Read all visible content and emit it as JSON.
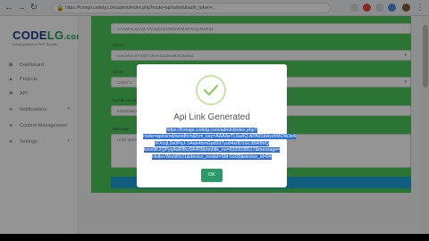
{
  "browser": {
    "url": "https://fcmapi.codelg.com/admin/index.php?route=api/admin&auth_token=...",
    "nav_back": "←",
    "nav_forward": "→",
    "nav_reload": "↻",
    "lock": "🔒"
  },
  "sidebar": {
    "logo_code": "CODE",
    "logo_lg": "LG",
    "logo_com": ".com",
    "logo_color_code": "#1b3a8c",
    "logo_color_lg": "#1aa34a",
    "logo_sub": "Development & PHP Scripts",
    "items": [
      {
        "icon": "◉",
        "label": "Dashboard",
        "has_chevron": false
      },
      {
        "icon": "▲",
        "label": "Projects",
        "has_chevron": false
      },
      {
        "icon": "■",
        "label": "API",
        "has_chevron": false
      },
      {
        "icon": "●",
        "label": "Notifications",
        "has_chevron": true
      },
      {
        "icon": "●",
        "label": "Content Management",
        "has_chevron": false
      },
      {
        "icon": "●",
        "label": "Settings",
        "has_chevron": true
      }
    ]
  },
  "form": {
    "fields": [
      {
        "label": "",
        "value": "AAAAeTL6aAQ:APA91bHyzhMOWJe4rFXcqL9s0PqJ",
        "caret": false
      },
      {
        "label": "Server",
        "value": "conceive SP.XIDI-ClientGuidewebScanned",
        "caret": true
      },
      {
        "label": "Client",
        "value": "CARC 1",
        "caret": true
      },
      {
        "label": "Mobile Number",
        "value": "9320038517",
        "caret": false
      },
      {
        "label": "Message",
        "value": "Hello World",
        "caret": false
      }
    ],
    "accent_green": "#4bc95b",
    "submit_color": "#1aa3d8"
  },
  "modal": {
    "title": "Api Link Generated",
    "check_color": "#8fd05a",
    "link_lines": [
      "https://fcmapi.codelg.com/admin/index.php?",
      "route=api/send/sendfcm&fcm_key=AAAAeTL6aAQ:APA91bHyzhMOWJe4",
      "rFXcqL9s0PqJ-1l4ab4bmGpd2d7yu04x0D1GL9BRBtIQ",
      "kzvs9K2QPyqAaR8hz9A4Rf&mobile_no=9320038517&message=",
      "Hello+World%21&device_model=SM-G930&device_id=84"
    ],
    "ok_label": "OK"
  }
}
